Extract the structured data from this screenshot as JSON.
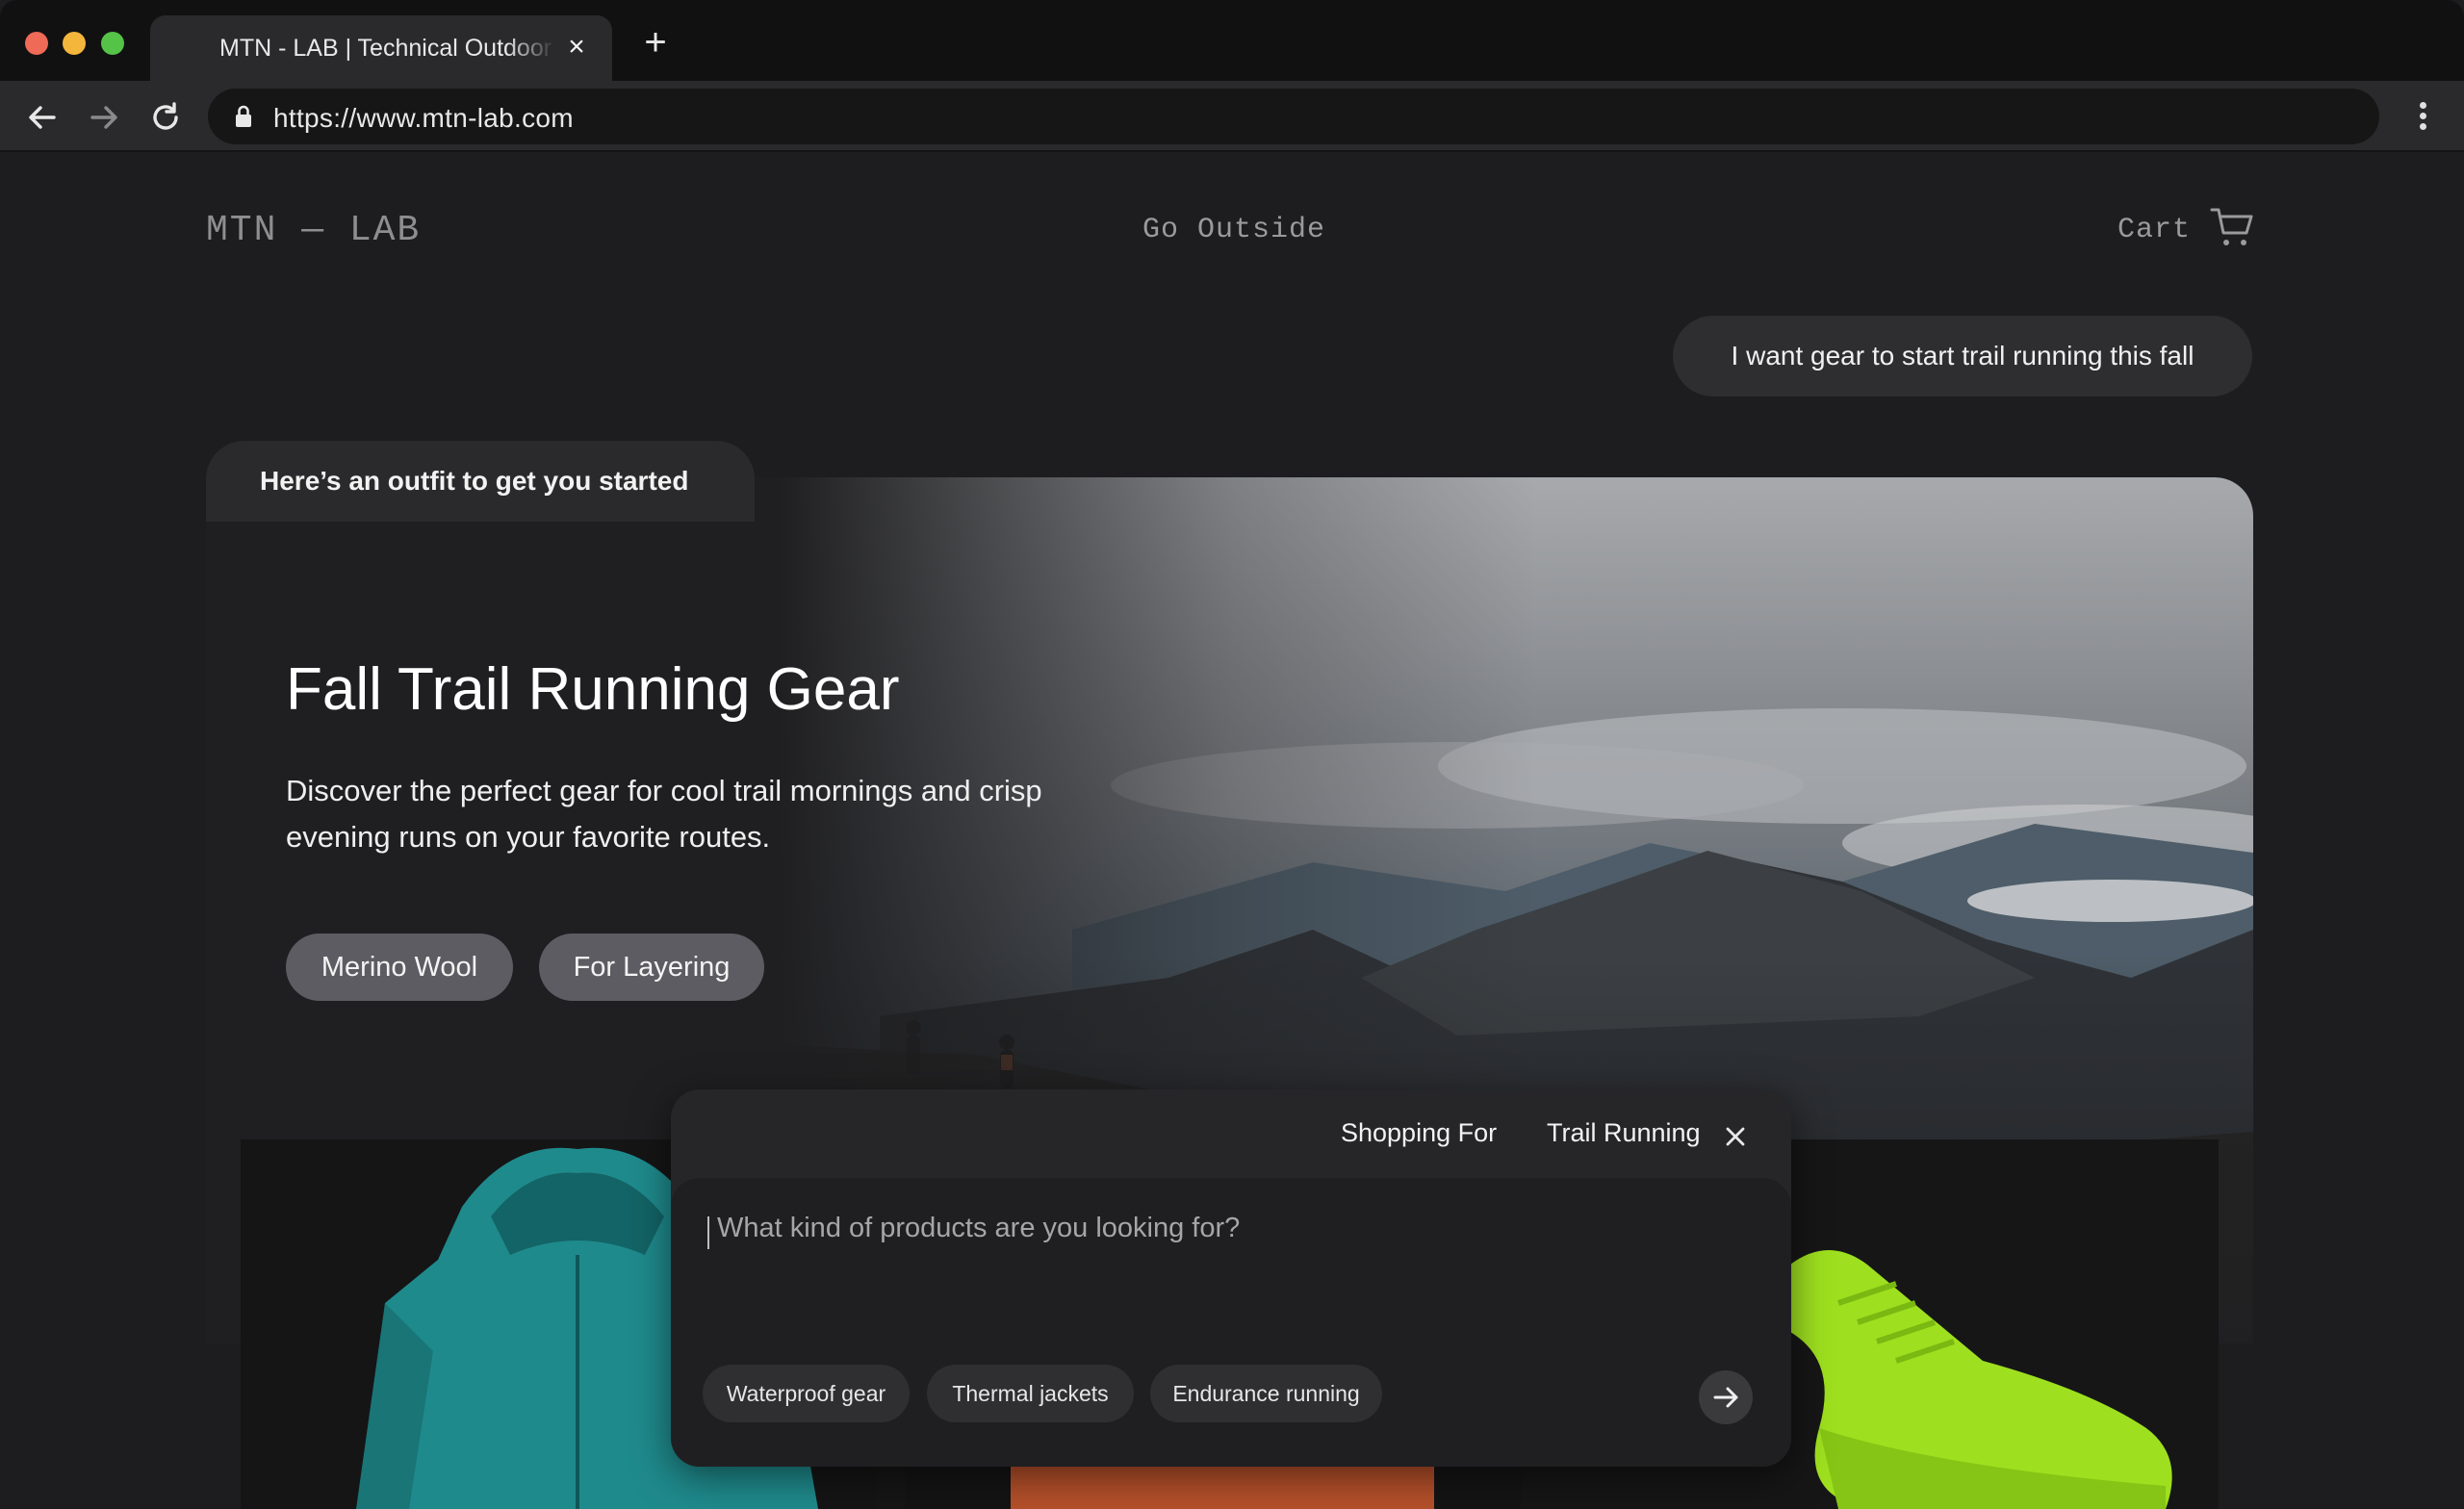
{
  "browser": {
    "tab_title": "MTN - LAB  |  Technical Outdoor",
    "tab_close": "×",
    "new_tab": "+",
    "url": "https://www.mtn-lab.com"
  },
  "header": {
    "logo": "MTN — LAB",
    "center_link": "Go Outside",
    "cart": "Cart"
  },
  "chat": {
    "user_message": "I want gear to start trail running this fall",
    "assistant_tag": "Here’s an outfit to get you started"
  },
  "hero": {
    "title": "Fall Trail Running Gear",
    "description": "Discover the perfect gear for cool trail mornings and crisp evening runs on your favorite routes.",
    "tags": [
      "Merino Wool",
      "For Layering"
    ]
  },
  "search": {
    "shopping_label": "Shopping For",
    "shopping_value": "Trail Running",
    "placeholder": "What kind of products are you looking for?",
    "suggestions": [
      "Waterproof gear",
      "Thermal jackets",
      "Endurance running"
    ]
  },
  "colors": {
    "background": "#1d1d1f",
    "jacket": "#1f8a8c",
    "shoe": "#9ee01f",
    "beanie": "#b5502a"
  },
  "icons": [
    "back-arrow-icon",
    "forward-arrow-icon",
    "reload-icon",
    "lock-icon",
    "kebab-menu-icon",
    "cart-icon",
    "close-icon",
    "send-arrow-icon"
  ]
}
